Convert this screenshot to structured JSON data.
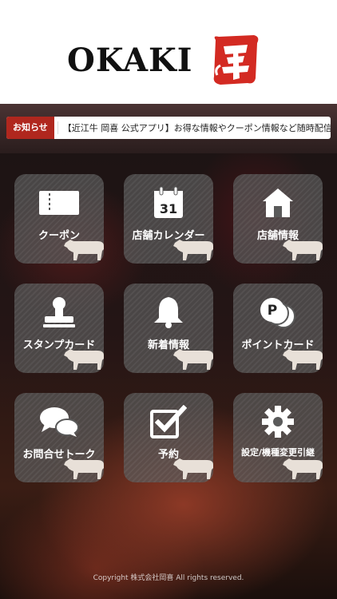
{
  "header": {
    "logo_text": "OKAKI",
    "logo_mark": "岡喜"
  },
  "news": {
    "badge": "お知らせ",
    "text": "【近江牛 岡喜 公式アプリ】お得な情報やクーポン情報など随時配信していきます"
  },
  "menu": {
    "items": [
      {
        "label": "クーポン",
        "icon": "coupon-icon"
      },
      {
        "label": "店舗カレンダー",
        "icon": "calendar-icon",
        "calendar_day": "31"
      },
      {
        "label": "店舗情報",
        "icon": "store-icon"
      },
      {
        "label": "スタンプカード",
        "icon": "stamp-icon"
      },
      {
        "label": "新着情報",
        "icon": "bell-icon"
      },
      {
        "label": "ポイントカード",
        "icon": "point-icon",
        "point_letter": "P"
      },
      {
        "label": "お問合せトーク",
        "icon": "chat-icon"
      },
      {
        "label": "予約",
        "icon": "check-icon"
      },
      {
        "label": "設定/機種変更引継",
        "icon": "gear-icon"
      }
    ]
  },
  "footer": {
    "copyright": "Copyright 株式会社岡喜 All rights reserved."
  },
  "colors": {
    "accent": "#b0271e",
    "tile": "#5a5a5a",
    "cow": "#e8e0d8"
  }
}
